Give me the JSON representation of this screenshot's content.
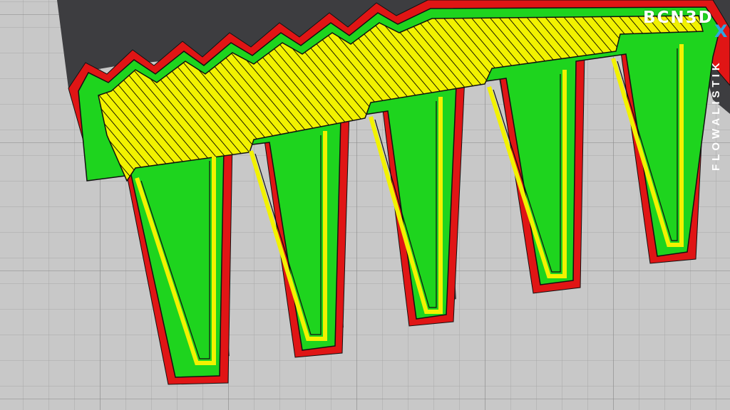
{
  "viewer": {
    "brand_logo": "BCN3D",
    "brand_logo_mark": "X",
    "side_brand": "FLOWALISTIK"
  },
  "colors": {
    "build_plate": "#c8c8c8",
    "grid_line": "#8c8c8c",
    "part_shadow": "#3c3c3e",
    "outer_wall": "#e01515",
    "inner_wall": "#1ed41e",
    "infill": "#f2f200",
    "toolpath_gap": "#111111",
    "logo_accent": "#2ea6e0"
  },
  "legend_semantics": [
    "outer-wall",
    "inner-wall",
    "infill"
  ]
}
